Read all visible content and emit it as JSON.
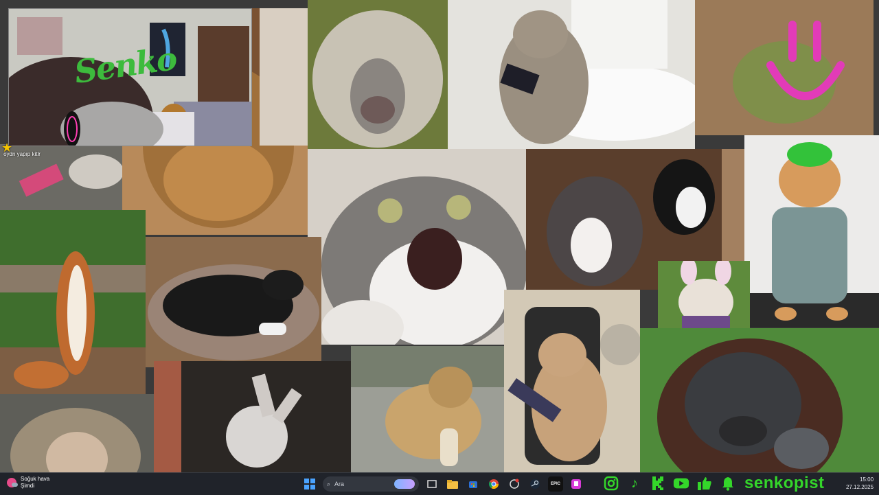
{
  "overlay": {
    "wall_text": "Senko",
    "star_note": "oydn yapıp kitlr"
  },
  "taskbar": {
    "weather": {
      "title": "Soğuk hava",
      "subtitle": "Şimdi"
    },
    "search_placeholder": "Ara",
    "apps": [
      "windows-start",
      "task-view",
      "file-explorer",
      "store",
      "chrome",
      "app-extra",
      "steam",
      "epic-games",
      "twitch"
    ],
    "brand": "senkopist",
    "time": "15:00",
    "date": "27.12.2025"
  },
  "colors": {
    "accent_green": "#34d62a",
    "taskbar_bg": "#20232a"
  },
  "icons": [
    "instagram-icon",
    "tiktok-icon",
    "kick-icon",
    "youtube-icon",
    "like-icon",
    "bell-icon"
  ]
}
